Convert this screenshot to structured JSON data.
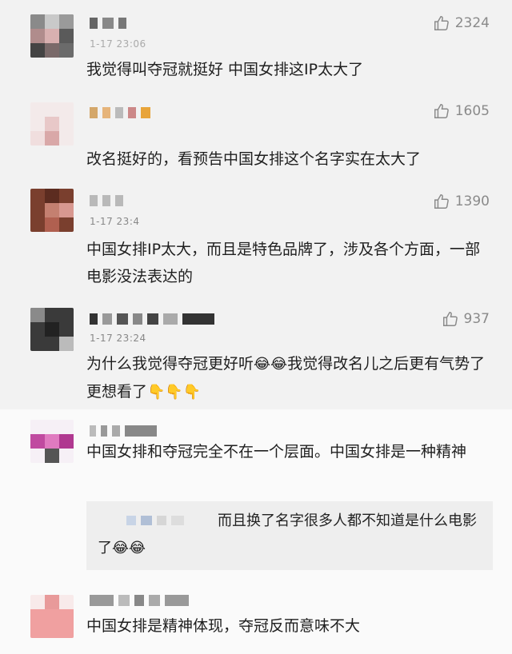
{
  "comments": [
    {
      "likes": "2324",
      "time": "1-17 23:06",
      "text": "我觉得叫夺冠就挺好 中国女排这IP太大了"
    },
    {
      "likes": "1605",
      "text": "改名挺好的，看预告中国女排这个名字实在太大了"
    },
    {
      "likes": "1390",
      "time": "1-17 23:4",
      "text": "中国女排IP太大，而且是特色品牌了，涉及各个方面，一部电影没法表达的"
    },
    {
      "likes": "937",
      "time": "1-17 23:24",
      "text_a": "为什么我觉得夺冠更好听",
      "text_b": "我觉得改名儿之后更有气势了 更想看了"
    },
    {
      "text": "中国女排和夺冠完全不在一个层面。中国女排是一种精神"
    },
    {
      "text": "中国女排是精神体现，夺冠反而意味不大"
    }
  ],
  "reply": {
    "text": "而且换了名字很多人都不知道是什么电影了"
  },
  "icons": {
    "like": "thumbs-up-icon",
    "laugh": "laughing-crying-emoji",
    "point": "pointing-down-emoji"
  },
  "colors": {
    "bg_top": "#f2f2f2",
    "bg_bottom": "#fafafa",
    "reply_bg": "#eeeeee",
    "muted": "#8a8a8a"
  }
}
